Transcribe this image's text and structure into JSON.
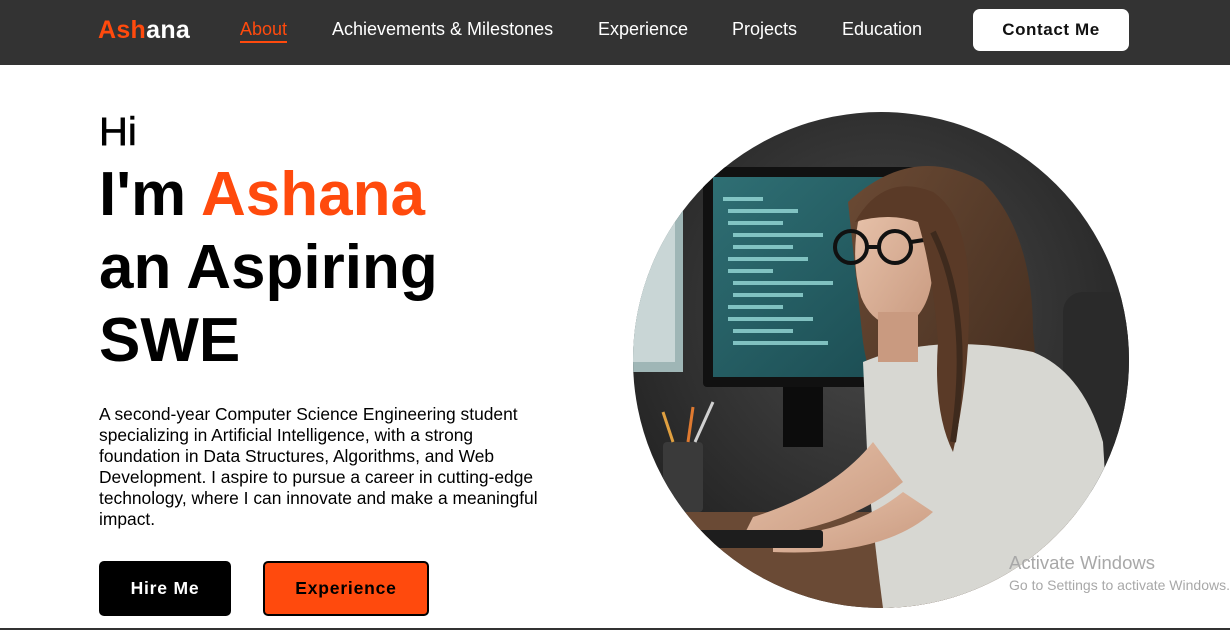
{
  "nav": {
    "logo_part1": "Ash",
    "logo_part2": "ana",
    "links": [
      "About",
      "Achievements & Milestones",
      "Experience",
      "Projects",
      "Education"
    ],
    "active_link": "About",
    "contact_label": "Contact Me"
  },
  "hero": {
    "greeting": "Hi",
    "im_prefix": "I'm ",
    "name": "Ashana",
    "line2": "an Aspiring",
    "line3": "SWE",
    "bio": "A second-year Computer Science Engineering student specializing in Artificial Intelligence, with a strong foundation in Data Structures, Algorithms, and Web Development. I aspire to pursue a career in cutting-edge technology, where I can innovate and make a meaningful impact.",
    "hire_label": "Hire Me",
    "experience_label": "Experience"
  },
  "watermark": {
    "title": "Activate Windows",
    "subtitle": "Go to Settings to activate Windows."
  },
  "colors": {
    "accent": "#ff4a0d",
    "navbar_bg": "#333333"
  }
}
